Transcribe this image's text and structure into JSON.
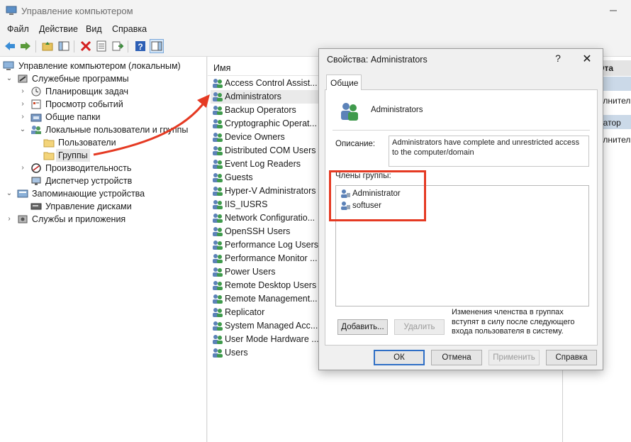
{
  "window": {
    "title": "Управление компьютером"
  },
  "menu": [
    "Файл",
    "Действие",
    "Вид",
    "Справка"
  ],
  "tree": {
    "root": "Управление компьютером (локальным)",
    "items": [
      "Служебные программы",
      "Планировщик задач",
      "Просмотр событий",
      "Общие папки",
      "Локальные пользователи и группы",
      "Пользователи",
      "Группы",
      "Производительность",
      "Диспетчер устройств",
      "Запоминающие устройства",
      "Управление дисками",
      "Службы и приложения"
    ]
  },
  "list": {
    "header": "Имя",
    "items": [
      "Access Control Assist...",
      "Administrators",
      "Backup Operators",
      "Cryptographic Operat...",
      "Device Owners",
      "Distributed COM Users",
      "Event Log Readers",
      "Guests",
      "Hyper-V Administrators",
      "IIS_IUSRS",
      "Network Configuratio...",
      "OpenSSH Users",
      "Performance Log Users",
      "Performance Monitor ...",
      "Power Users",
      "Remote Desktop Users",
      "Remote Management...",
      "Replicator",
      "System Managed Acc...",
      "User Mode Hardware ...",
      "Users"
    ]
  },
  "right_pane": {
    "header": "Эта",
    "rows": [
      "олнител",
      "ратор",
      "олнител"
    ]
  },
  "dialog": {
    "title": "Свойства: Administrators",
    "help": "?",
    "close": "✕",
    "tab": "Общие",
    "group_name": "Administrators",
    "description_label": "Описание:",
    "description": "Administrators have complete and unrestricted access to the computer/domain",
    "members_label": "Члены группы:",
    "members": [
      "Administrator",
      "softuser"
    ],
    "add_button": "Добавить...",
    "remove_button": "Удалить",
    "note": "Изменения членства в группах вступят в силу после следующего входа пользователя в систему.",
    "ok": "ОК",
    "cancel": "Отмена",
    "apply": "Применить",
    "help_button": "Справка"
  },
  "colors": {
    "accent": "#e53a23",
    "selection": "#cbd9e8"
  }
}
